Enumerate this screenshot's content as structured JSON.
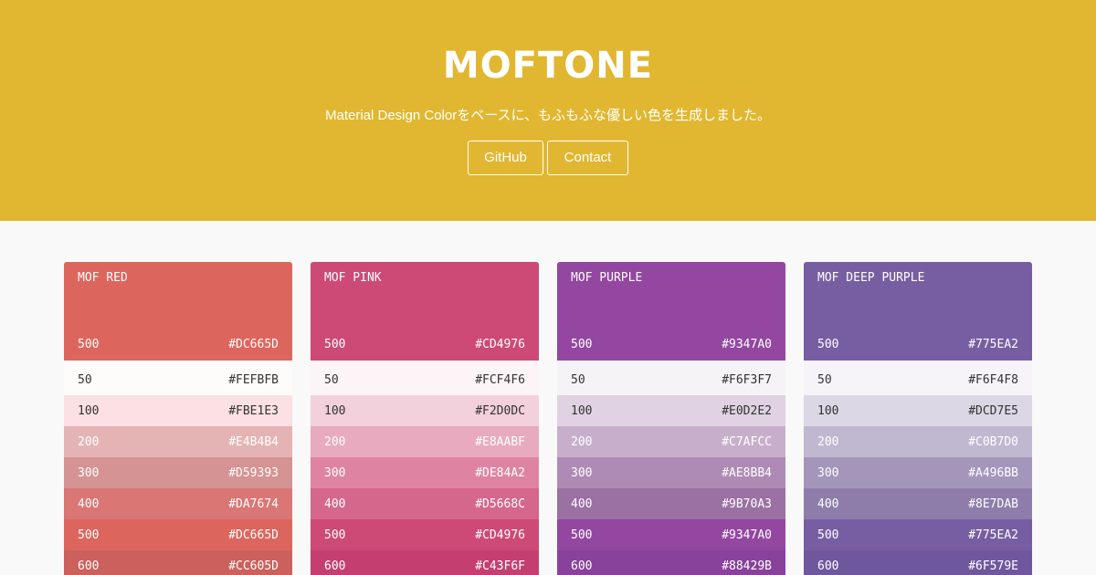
{
  "hero": {
    "title": "MOFTONE",
    "subtitle": "Material Design Colorをベースに、もふもふな優しい色を生成しました。",
    "buttons": {
      "github": "GitHub",
      "contact": "Contact"
    },
    "background": "#E1B731"
  },
  "palettes": [
    {
      "name": "MOF RED",
      "main": {
        "level": "500",
        "hex": "#DC665D"
      },
      "swatches": [
        {
          "level": "50",
          "hex": "#FEFBFB"
        },
        {
          "level": "100",
          "hex": "#FBE1E3"
        },
        {
          "level": "200",
          "hex": "#E4B4B4"
        },
        {
          "level": "300",
          "hex": "#D59393"
        },
        {
          "level": "400",
          "hex": "#DA7674"
        },
        {
          "level": "500",
          "hex": "#DC665D"
        },
        {
          "level": "600",
          "hex": "#CC605D"
        }
      ]
    },
    {
      "name": "MOF PINK",
      "main": {
        "level": "500",
        "hex": "#CD4976"
      },
      "swatches": [
        {
          "level": "50",
          "hex": "#FCF4F6"
        },
        {
          "level": "100",
          "hex": "#F2D0DC"
        },
        {
          "level": "200",
          "hex": "#E8AABF"
        },
        {
          "level": "300",
          "hex": "#DE84A2"
        },
        {
          "level": "400",
          "hex": "#D5668C"
        },
        {
          "level": "500",
          "hex": "#CD4976"
        },
        {
          "level": "600",
          "hex": "#C43F6F"
        }
      ]
    },
    {
      "name": "MOF PURPLE",
      "main": {
        "level": "500",
        "hex": "#9347A0"
      },
      "swatches": [
        {
          "level": "50",
          "hex": "#F6F3F7"
        },
        {
          "level": "100",
          "hex": "#E0D2E2"
        },
        {
          "level": "200",
          "hex": "#C7AFCC"
        },
        {
          "level": "300",
          "hex": "#AE8BB4"
        },
        {
          "level": "400",
          "hex": "#9B70A3"
        },
        {
          "level": "500",
          "hex": "#9347A0"
        },
        {
          "level": "600",
          "hex": "#88429B"
        }
      ]
    },
    {
      "name": "MOF DEEP PURPLE",
      "main": {
        "level": "500",
        "hex": "#775EA2"
      },
      "swatches": [
        {
          "level": "50",
          "hex": "#F6F4F8"
        },
        {
          "level": "100",
          "hex": "#DCD7E5"
        },
        {
          "level": "200",
          "hex": "#C0B7D0"
        },
        {
          "level": "300",
          "hex": "#A496BB"
        },
        {
          "level": "400",
          "hex": "#8E7DAB"
        },
        {
          "level": "500",
          "hex": "#775EA2"
        },
        {
          "level": "600",
          "hex": "#6F579E"
        }
      ]
    }
  ]
}
